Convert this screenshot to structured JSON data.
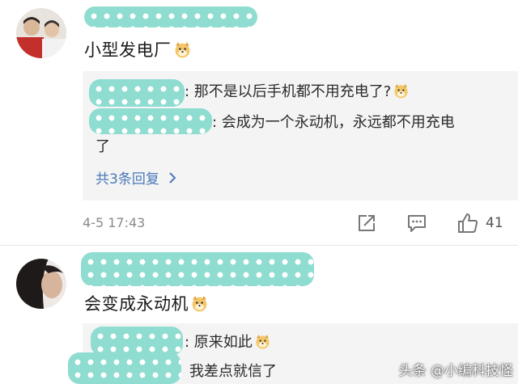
{
  "comments": [
    {
      "text": "小型发电厂",
      "replies": [
        {
          "text": ": 那不是以后手机都不用充电了?"
        },
        {
          "text": ": 会成为一个永动机，永远都不用充电",
          "cont": "了"
        }
      ],
      "more_label": "共3条回复",
      "time": "4-5 17:43",
      "likes": "41"
    },
    {
      "text": "会变成永动机",
      "replies": [
        {
          "text": ": 原来如此"
        },
        {
          "text": "我差点就信了"
        }
      ]
    }
  ],
  "watermark": "头条 @小编科技怪",
  "colors": {
    "link": "#4a79b8",
    "mask": "#8fdcd0"
  }
}
